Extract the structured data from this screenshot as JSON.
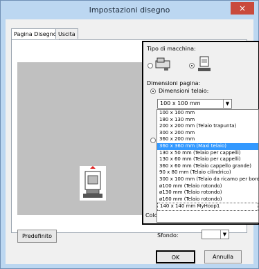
{
  "window": {
    "title": "Impostazioni disegno",
    "close_glyph": "×"
  },
  "tabs": [
    {
      "label": "Pagina Disegno"
    },
    {
      "label": "Uscita"
    }
  ],
  "machine_type": {
    "label": "Tipo di macchina:",
    "option_a_selected": false,
    "option_b_selected": true
  },
  "page_size": {
    "label": "Dimensioni pagina:",
    "hoop_label": "Dimensioni telaio:",
    "hoop_selected": "100 x 100 mm",
    "options": [
      "100 x 100 mm",
      "180 x 130 mm",
      "200 x 200 mm (Telaio trapunta)",
      "300 x 200 mm",
      "360 x 200 mm",
      "360 x 360 mm (Maxi telaio)",
      "130 x  50 mm (Telaio per cappelli)",
      "130 x  60 mm (Telaio per cappelli)",
      "360 x  60 mm (Telaio cappello grande)",
      " 90 x  80 mm (Telaio cilindrico)",
      "300 x 100 mm (Telaio da ricamo per bordi)",
      "ø100 mm (Telaio rotondo)",
      "ø130 mm (Telaio rotondo)",
      "ø160 mm (Telaio rotondo)",
      "140 x 140 mm MyHoop1"
    ],
    "highlighted_index": 5,
    "partial_label": "Colo"
  },
  "buttons": {
    "default": "Predefinito",
    "ok": "OK",
    "cancel": "Annulla"
  },
  "background": {
    "label": "Sfondo:"
  }
}
